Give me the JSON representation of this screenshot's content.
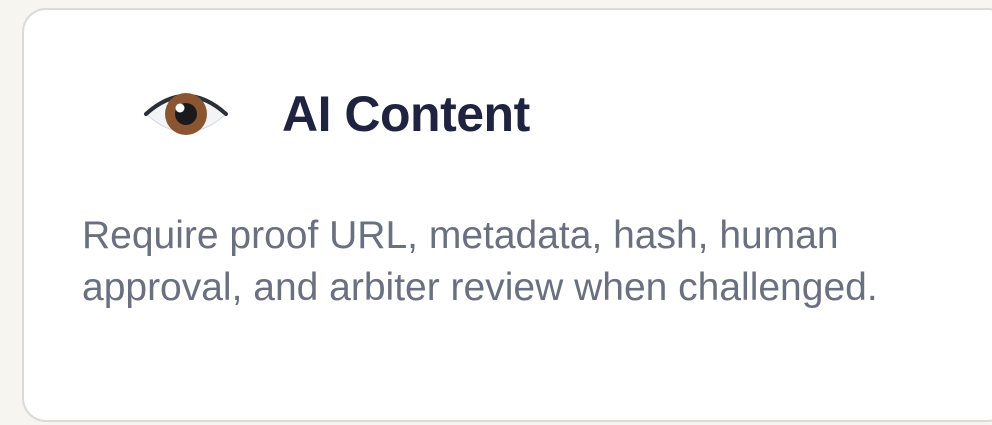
{
  "card": {
    "icon": "eye-icon",
    "title": "AI Content",
    "description": "Require proof URL, metadata, hash, human approval, and arbiter review when challenged."
  }
}
